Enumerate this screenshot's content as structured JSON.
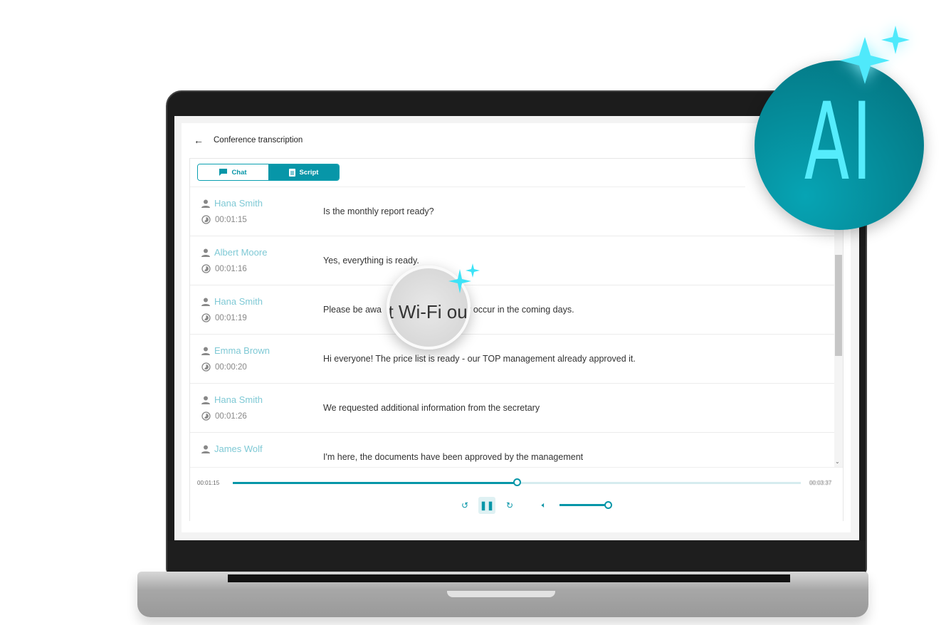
{
  "app": {
    "title": "Conference transcription",
    "back_icon": "arrow-left-icon"
  },
  "tabs": [
    {
      "label": "Chat",
      "icon": "chat-bubble-icon",
      "active": false
    },
    {
      "label": "Script",
      "icon": "document-icon",
      "active": true
    }
  ],
  "transcript": [
    {
      "speaker": "Hana Smith",
      "time": "00:01:15",
      "text": "Is the monthly report ready?"
    },
    {
      "speaker": "Albert Moore",
      "time": "00:01:16",
      "text": "Yes, everything is ready."
    },
    {
      "speaker": "Hana Smith",
      "time": "00:01:19",
      "text": "Please be awa",
      "text_after": "s may occur in the coming days."
    },
    {
      "speaker": "Emma Brown",
      "time": "00:00:20",
      "text": "Hi everyone! The price list is ready - our TOP management already approved it."
    },
    {
      "speaker": "Hana Smith",
      "time": "00:01:26",
      "text": "We requested additional information from the secretary"
    },
    {
      "speaker": "James Wolf",
      "time": "",
      "text": "I'm here, the documents have been approved by the management"
    }
  ],
  "magnifier": {
    "text": "at Wi-Fi ou"
  },
  "player": {
    "current_time": "00:01:15",
    "total_time": "00:03:37",
    "progress_percent": 50,
    "volume_percent": 100,
    "state": "playing"
  },
  "badge": {
    "text": "AI"
  },
  "colors": {
    "accent": "#0796a8",
    "speaker": "#7fc9d5",
    "ai_glow": "#55ecfc"
  }
}
